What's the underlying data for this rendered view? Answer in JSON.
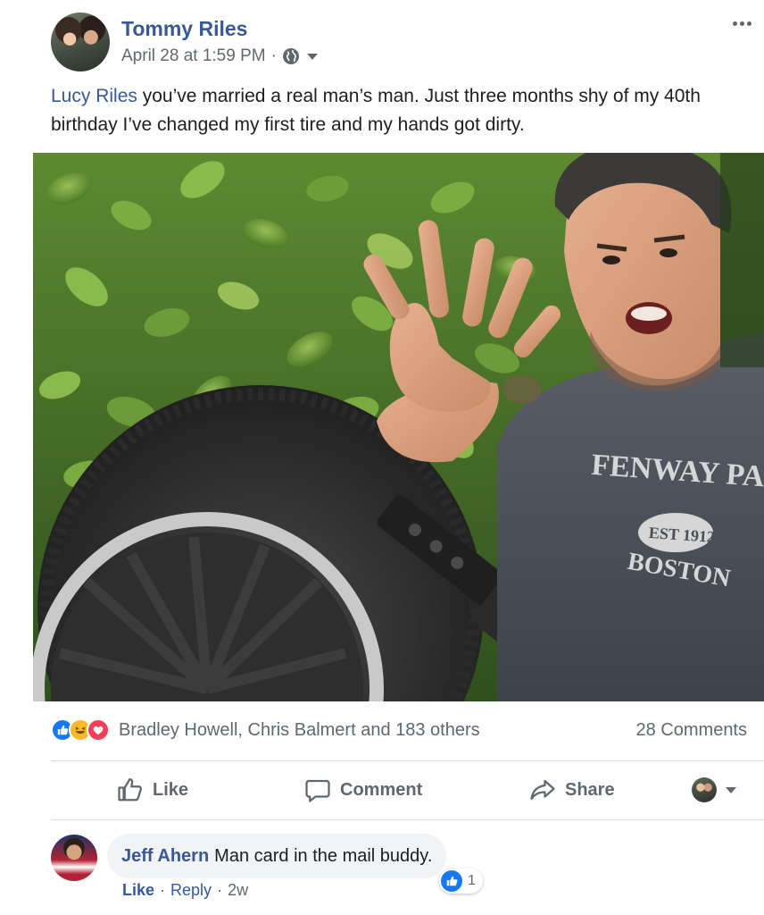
{
  "post": {
    "author": "Tommy Riles",
    "date": "April 28 at 1:59 PM",
    "separator": "·",
    "privacy_icon": "globe-icon",
    "mention": "Lucy Riles",
    "text": " you’ve married a real man’s man. Just three months shy of my 40th birthday I’ve changed my first tire and my hands got dirty.",
    "photo_shirt_text_1": "FENWAY PARK",
    "photo_shirt_text_2": "EST 1912",
    "photo_shirt_text_3": "BOSTON"
  },
  "reactions": {
    "icons": [
      "like-reaction-icon",
      "haha-reaction-icon",
      "love-reaction-icon"
    ],
    "reactors": "Bradley Howell, Chris Balmert and 183 others",
    "comments_count": "28 Comments"
  },
  "actions": {
    "like": "Like",
    "comment": "Comment",
    "share": "Share"
  },
  "comment": {
    "author": "Jeff Ahern",
    "text": "Man card in the mail buddy.",
    "reaction_count": "1",
    "like": "Like",
    "reply": "Reply",
    "time": "2w",
    "dot": "·"
  },
  "colors": {
    "link": "#385898",
    "meta": "#606770",
    "like_blue": "#1877f2",
    "haha_yellow": "#f7b928",
    "love_red": "#f33e58"
  }
}
